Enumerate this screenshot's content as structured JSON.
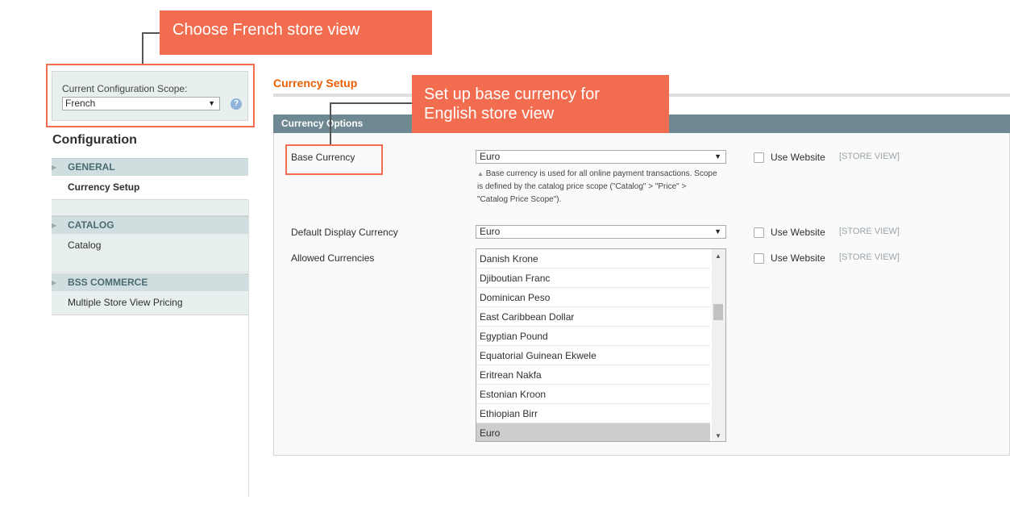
{
  "callouts": {
    "scope": "Choose French store view",
    "currency_line1": "Set up base currency for",
    "currency_line2": "English store view"
  },
  "scope": {
    "label": "Current Configuration Scope:",
    "value": "French"
  },
  "sidebar": {
    "title": "Configuration",
    "groups": [
      {
        "label": "GENERAL",
        "items": [
          "Currency Setup"
        ]
      },
      {
        "label": "CATALOG",
        "items": [
          "Catalog"
        ]
      },
      {
        "label": "BSS COMMERCE",
        "items": [
          "Multiple Store View Pricing"
        ]
      }
    ]
  },
  "main": {
    "section_title": "Currency Setup",
    "fieldset_title": "Currency Options",
    "base_currency": {
      "label": "Base Currency",
      "value": "Euro",
      "note": "Base currency is used for all online payment transactions. Scope is defined by the catalog price scope (\"Catalog\" > \"Price\" > \"Catalog Price Scope\")."
    },
    "default_display": {
      "label": "Default Display Currency",
      "value": "Euro"
    },
    "allowed": {
      "label": "Allowed Currencies",
      "options": [
        "Danish Krone",
        "Djiboutian Franc",
        "Dominican Peso",
        "East Caribbean Dollar",
        "Egyptian Pound",
        "Equatorial Guinean Ekwele",
        "Eritrean Nakfa",
        "Estonian Kroon",
        "Ethiopian Birr",
        "Euro"
      ],
      "selected": "Euro"
    },
    "use_website_label": "Use Website",
    "scope_tag": "[STORE VIEW]"
  },
  "icons": {
    "help": "help-icon",
    "dropdown": "chevron-down-icon",
    "collapse": "triangle-right-icon"
  }
}
